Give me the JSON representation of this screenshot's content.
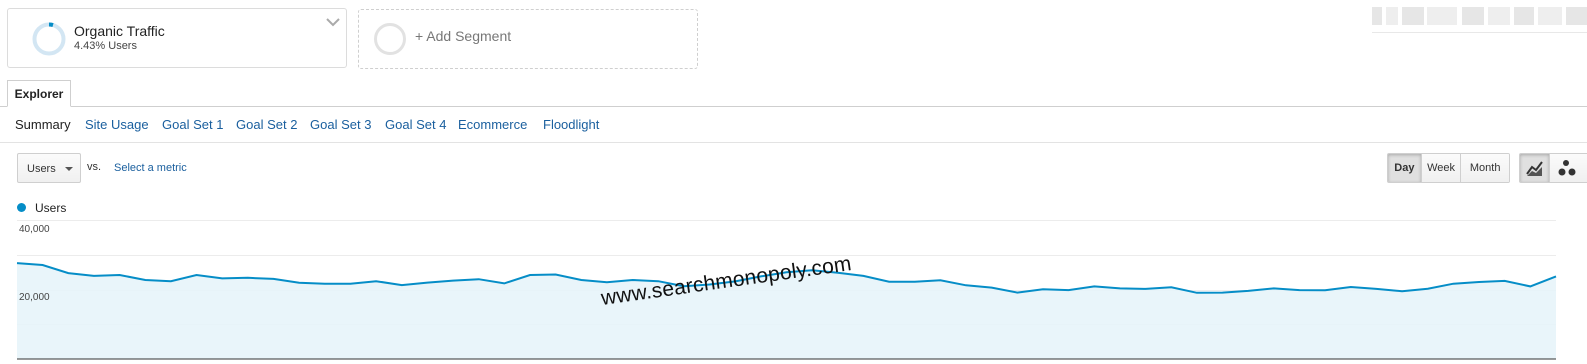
{
  "segment": {
    "name": "Organic Traffic",
    "subtitle": "4.43% Users",
    "percent": 4.43
  },
  "add_segment": {
    "label": "+ Add Segment"
  },
  "tabs": {
    "explorer": "Explorer"
  },
  "subtabs": [
    {
      "label": "Summary",
      "active": true
    },
    {
      "label": "Site Usage"
    },
    {
      "label": "Goal Set 1"
    },
    {
      "label": "Goal Set 2"
    },
    {
      "label": "Goal Set 3"
    },
    {
      "label": "Goal Set 4"
    },
    {
      "label": "Ecommerce"
    },
    {
      "label": "Floodlight"
    }
  ],
  "controls": {
    "metric": "Users",
    "vs": "vs.",
    "select_metric": "Select a metric",
    "periods": [
      "Day",
      "Week",
      "Month"
    ],
    "active_period": "Day",
    "chart_icons": [
      "line-chart-icon",
      "motion-chart-icon"
    ]
  },
  "watermark": "www.searchmonopoly.com",
  "colors": {
    "series": "#058dc7",
    "area": "#e7f4fa",
    "link": "#1a5f9e"
  },
  "chart_data": {
    "type": "area",
    "legend": [
      "Users"
    ],
    "yticks": [
      "40,000",
      "20,000"
    ],
    "ylim": [
      0,
      50000
    ],
    "grid": true,
    "series": [
      {
        "name": "Users",
        "values": [
          34500,
          33800,
          30900,
          29900,
          30200,
          28400,
          28000,
          30200,
          29000,
          29200,
          28800,
          27400,
          27100,
          27100,
          28000,
          26600,
          27500,
          28200,
          28700,
          27200,
          30200,
          30400,
          28400,
          27600,
          28400,
          28000,
          26200,
          26800,
          27900,
          29700,
          31200,
          31900,
          31000,
          29900,
          27800,
          27800,
          28300,
          26500,
          25700,
          23900,
          25100,
          24800,
          26100,
          25400,
          25200,
          25800,
          23800,
          23900,
          24500,
          25400,
          24800,
          24700,
          25900,
          25200,
          24400,
          25300,
          27100,
          27700,
          28100,
          26100,
          29700
        ]
      }
    ]
  }
}
